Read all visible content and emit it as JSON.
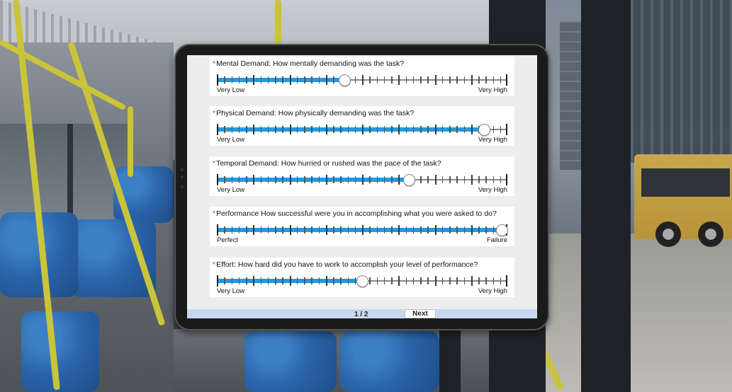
{
  "survey": {
    "questions": [
      {
        "required_mark": "*",
        "title": "Mental Demand: How mentally demanding was the task?",
        "low_label": "Very Low",
        "high_label": "Very High",
        "value": 0.44
      },
      {
        "required_mark": "*",
        "title": "Physical Demand: How physically demanding was the task?",
        "low_label": "Very Low",
        "high_label": "Very High",
        "value": 0.92
      },
      {
        "required_mark": "*",
        "title": "Temporal Demand: How hurried or rushed was the pace of the task?",
        "low_label": "Very Low",
        "high_label": "Very High",
        "value": 0.66
      },
      {
        "required_mark": "*",
        "title": "Performance How successful were you in accomplishing what you were asked to do?",
        "low_label": "Perfect",
        "high_label": "Failure",
        "value": 0.98
      },
      {
        "required_mark": "*",
        "title": "Effort: How hard did you have to work to accomplish your level of performance?",
        "low_label": "Very Low",
        "high_label": "Very High",
        "value": 0.5
      }
    ]
  },
  "footer": {
    "page_indicator": "1 / 2",
    "next_label": "Next"
  },
  "colors": {
    "slider_fill": "#1e9be6",
    "required_mark": "#e0302a",
    "footer_bar": "#c6d8f0"
  }
}
